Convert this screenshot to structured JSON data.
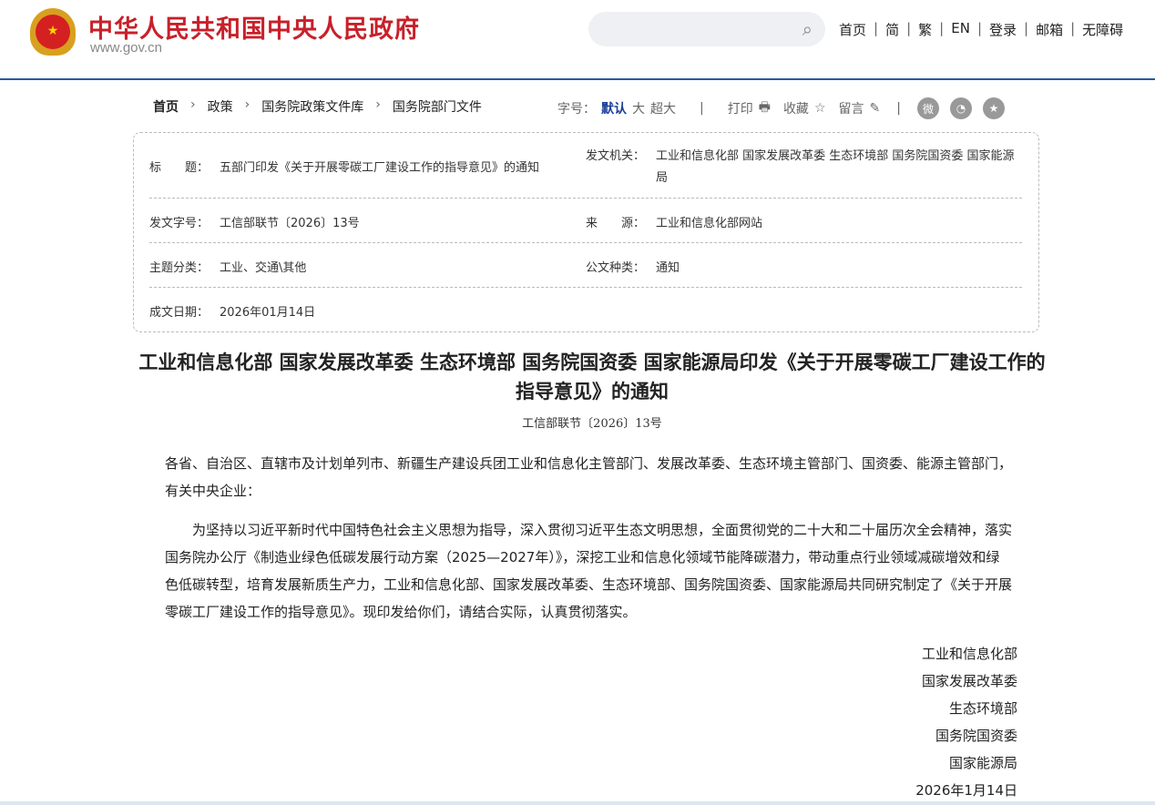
{
  "header": {
    "site_title": "中华人民共和国中央人民政府",
    "site_url": "www.gov.cn",
    "emblem_label": "国徽",
    "search_placeholder": "",
    "nav": [
      "首页",
      "简",
      "繁",
      "EN",
      "登录",
      "邮箱",
      "无障碍"
    ]
  },
  "breadcrumb": [
    "首页",
    "政策",
    "国务院政策文件库",
    "国务院部门文件"
  ],
  "tools": {
    "font_label": "字号：",
    "font_sizes": [
      "默认",
      "大",
      "超大"
    ],
    "print": "打印",
    "favorite": "收藏",
    "comment": "留言",
    "share": [
      "weibo",
      "wechat",
      "favorites"
    ]
  },
  "meta": {
    "title_label": "标　　题：",
    "title": "五部门印发《关于开展零碳工厂建设工作的指导意见》的通知",
    "issuer_label": "发文机关：",
    "issuer": "工业和信息化部 国家发展改革委 生态环境部 国务院国资委 国家能源局",
    "docno_label": "发文字号：",
    "docno": "工信部联节〔2026〕13号",
    "source_label": "来　　源：",
    "source": "工业和信息化部网站",
    "topic_label": "主题分类：",
    "topic": "工业、交通\\其他",
    "type_label": "公文种类：",
    "type": "通知",
    "date_label": "成文日期：",
    "date": "2026年01月14日"
  },
  "article": {
    "title": "工业和信息化部 国家发展改革委 生态环境部 国务院国资委 国家能源局印发《关于开展零碳工厂建设工作的指导意见》的通知",
    "docno": "工信部联节〔2026〕13号",
    "recipients": "各省、自治区、直辖市及计划单列市、新疆生产建设兵团工业和信息化主管部门、发展改革委、生态环境主管部门、国资委、能源主管部门，有关中央企业：",
    "para": "为坚持以习近平新时代中国特色社会主义思想为指导，深入贯彻习近平生态文明思想，全面贯彻党的二十大和二十届历次全会精神，落实国务院办公厅《制造业绿色低碳发展行动方案（2025—2027年）》，深挖工业和信息化领域节能降碳潜力，带动重点行业领域减碳增效和绿色低碳转型，培育发展新质生产力，工业和信息化部、国家发展改革委、生态环境部、国务院国资委、国家能源局共同研究制定了《关于开展零碳工厂建设工作的指导意见》。现印发给你们，请结合实际，认真贯彻落实。",
    "signers": [
      "工业和信息化部",
      "国家发展改革委",
      "生态环境部",
      "国务院国资委",
      "国家能源局"
    ],
    "date": "2026年1月14日"
  }
}
